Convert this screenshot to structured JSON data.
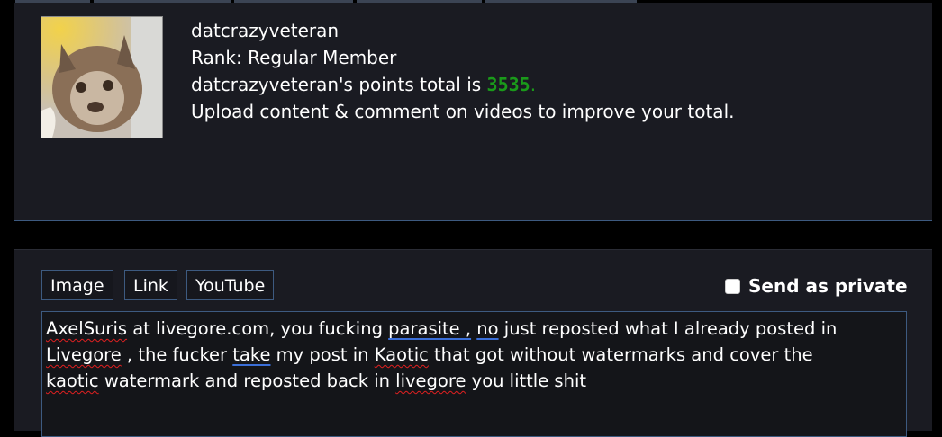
{
  "profile": {
    "username": "datcrazyveteran",
    "rank_line": "Rank: Regular Member",
    "points_prefix": "datcrazyveteran's points total is ",
    "points_value": "3535",
    "points_suffix": ".",
    "hint": "Upload content & comment on videos to improve your total."
  },
  "comment_form": {
    "buttons": [
      "Image",
      "Link",
      "YouTube"
    ],
    "send_private_label": "Send as private",
    "send_private_checked": false,
    "text_lines": [
      [
        "AxelSuris",
        " at livegore.com, you fucking ",
        "parasite ,",
        " ",
        "no",
        " just reposted what I already posted in"
      ],
      [
        "Livegore",
        " , the fucker ",
        "take",
        " my post in ",
        "Kaotic",
        " that got without watermarks and cover the"
      ],
      [
        "kaotic",
        " watermark and reposted back in ",
        "livegore",
        " you little shit"
      ]
    ]
  },
  "colors": {
    "points_green": "#1a9a1a",
    "border_blue": "#3d5a80",
    "card_bg": "#1a1b22",
    "spell_red": "#e02020",
    "grammar_blue": "#3b6fd8"
  }
}
